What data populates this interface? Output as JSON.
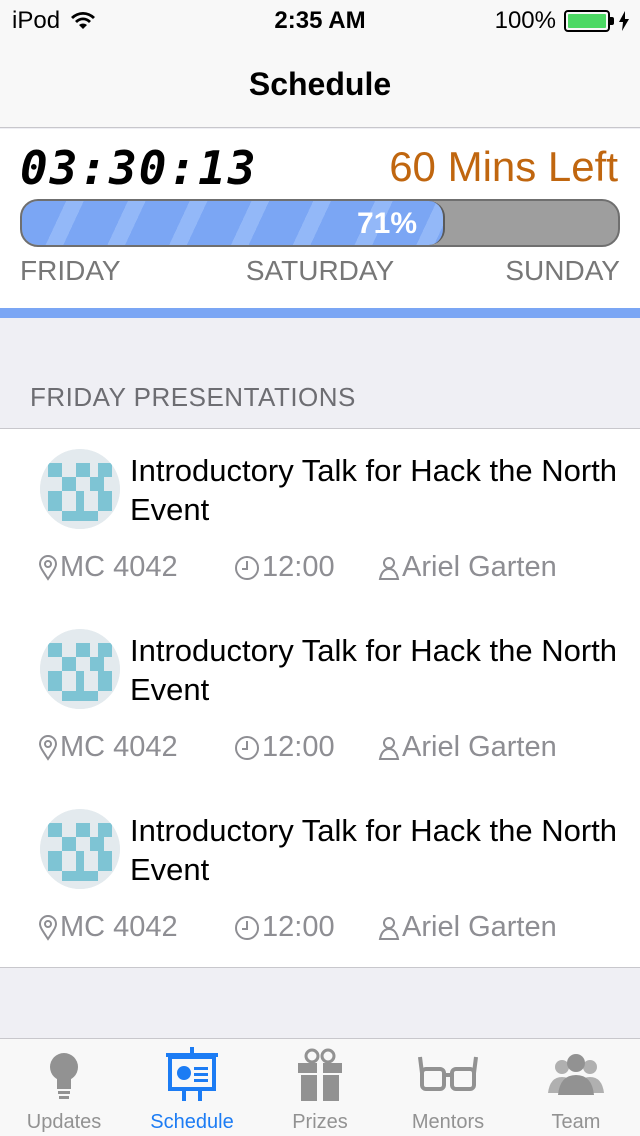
{
  "status_bar": {
    "carrier": "iPod",
    "time": "2:35 AM",
    "battery_pct": "100%",
    "battery_color": "#4cd964"
  },
  "nav": {
    "title": "Schedule"
  },
  "countdown": {
    "timer": "03:30:13",
    "mins_left": "60 Mins Left",
    "progress_label": "71%",
    "progress_fraction": 0.71,
    "accent_color": "#c0660f",
    "progress_color": "#7ba6f4",
    "days": [
      "FRIDAY",
      "SATURDAY",
      "SUNDAY"
    ]
  },
  "section": {
    "header": "FRIDAY PRESENTATIONS"
  },
  "events": [
    {
      "title": "Introductory Talk for Hack the North Event",
      "room": "MC 4042",
      "time": "12:00",
      "speaker": "Ariel Garten",
      "icon": "hack-the-north-logo"
    },
    {
      "title": "Introductory Talk for Hack the North Event",
      "room": "MC 4042",
      "time": "12:00",
      "speaker": "Ariel Garten",
      "icon": "hack-the-north-logo"
    },
    {
      "title": "Introductory Talk for Hack the North Event",
      "room": "MC 4042",
      "time": "12:00",
      "speaker": "Ariel Garten",
      "icon": "hack-the-north-logo"
    }
  ],
  "tabs": [
    {
      "label": "Updates",
      "icon": "lightbulb-icon",
      "active": false
    },
    {
      "label": "Schedule",
      "icon": "presentation-icon",
      "active": true
    },
    {
      "label": "Prizes",
      "icon": "gift-icon",
      "active": false
    },
    {
      "label": "Mentors",
      "icon": "glasses-icon",
      "active": false
    },
    {
      "label": "Team",
      "icon": "team-icon",
      "active": false
    }
  ],
  "colors": {
    "active_tab": "#1c7cf4",
    "inactive_tab": "#929292"
  }
}
